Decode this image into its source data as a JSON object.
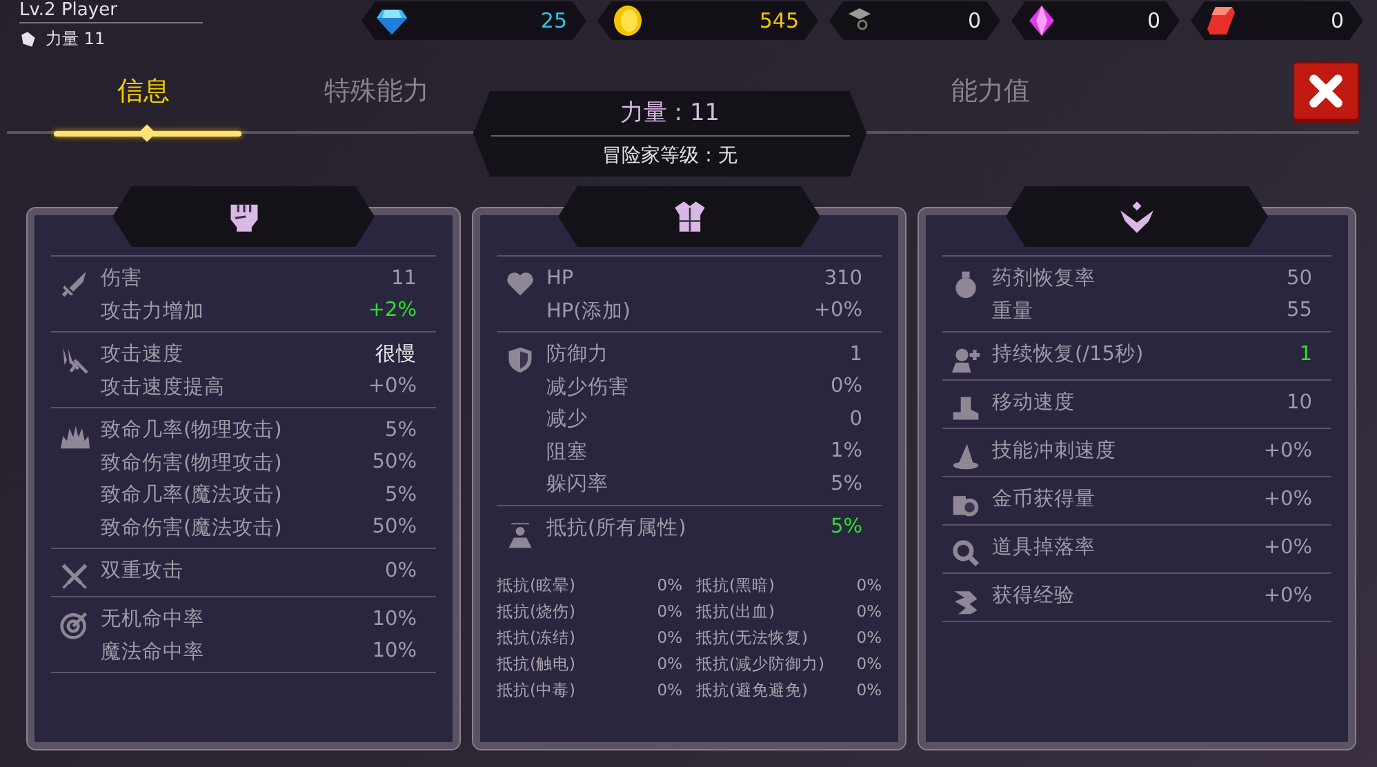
{
  "player": {
    "name": "Lv.2 Player",
    "stat": "力量 11"
  },
  "currencies": [
    {
      "kind": "diamond",
      "amount": "25"
    },
    {
      "kind": "gold",
      "amount": "545"
    },
    {
      "kind": "ore",
      "amount": "0"
    },
    {
      "kind": "crystal",
      "amount": "0"
    },
    {
      "kind": "ruby",
      "amount": "0"
    }
  ],
  "tabs": [
    {
      "label": "信息",
      "selected": true
    },
    {
      "label": "特殊能力",
      "selected": false
    },
    {
      "label": "能力值",
      "selected": false
    }
  ],
  "badge": {
    "title": "力量 : 11",
    "subtitle": "冒险家等级 : 无"
  },
  "panels": [
    {
      "groups": [
        {
          "rows": [
            {
              "label": "伤害",
              "value": "11",
              "kind": "normal"
            },
            {
              "label": "攻击力增加",
              "value": "+2%",
              "kind": "good"
            }
          ]
        },
        {
          "rows": [
            {
              "label": "攻击速度",
              "value": "很慢",
              "kind": "bright"
            },
            {
              "label": "攻击速度提高",
              "value": "+0%",
              "kind": "normal"
            }
          ]
        },
        {
          "rows": [
            {
              "label": "致命几率(物理攻击)",
              "value": "5%",
              "kind": "normal"
            },
            {
              "label": "致命伤害(物理攻击)",
              "value": "50%",
              "kind": "normal"
            },
            {
              "label": "致命几率(魔法攻击)",
              "value": "5%",
              "kind": "normal"
            },
            {
              "label": "致命伤害(魔法攻击)",
              "value": "50%",
              "kind": "normal"
            }
          ]
        },
        {
          "rows": [
            {
              "label": "双重攻击",
              "value": "0%",
              "kind": "normal"
            }
          ]
        },
        {
          "rows": [
            {
              "label": "无机命中率",
              "value": "10%",
              "kind": "normal"
            },
            {
              "label": "魔法命中率",
              "value": "10%",
              "kind": "normal"
            }
          ]
        }
      ]
    },
    {
      "groups": [
        {
          "rows": [
            {
              "label": "HP",
              "value": "310",
              "kind": "normal"
            },
            {
              "label": "HP(添加)",
              "value": "+0%",
              "kind": "normal"
            }
          ]
        },
        {
          "rows": [
            {
              "label": "防御力",
              "value": "1",
              "kind": "normal"
            },
            {
              "label": "减少伤害",
              "value": "0%",
              "kind": "normal"
            },
            {
              "label": "减少",
              "value": "0",
              "kind": "normal"
            },
            {
              "label": "阻塞",
              "value": "1%",
              "kind": "normal"
            },
            {
              "label": "躲闪率",
              "value": "5%",
              "kind": "normal"
            }
          ]
        },
        {
          "rows": [
            {
              "label": "抵抗(所有属性)",
              "value": "5%",
              "kind": "good"
            }
          ]
        }
      ],
      "resistances": [
        {
          "label": "抵抗(眩晕)",
          "value": "0%"
        },
        {
          "label": "抵抗(黑暗)",
          "value": "0%"
        },
        {
          "label": "抵抗(烧伤)",
          "value": "0%"
        },
        {
          "label": "抵抗(出血)",
          "value": "0%"
        },
        {
          "label": "抵抗(冻结)",
          "value": "0%"
        },
        {
          "label": "抵抗(无法恢复)",
          "value": "0%"
        },
        {
          "label": "抵抗(触电)",
          "value": "0%"
        },
        {
          "label": "抵抗(减少防御力)",
          "value": "0%"
        },
        {
          "label": "抵抗(中毒)",
          "value": "0%"
        },
        {
          "label": "抵抗(避免避免)",
          "value": "0%"
        }
      ]
    },
    {
      "groups": [
        {
          "rows": [
            {
              "label": "药剂恢复率",
              "value": "50",
              "kind": "normal"
            },
            {
              "label": "重量",
              "value": "55",
              "kind": "normal"
            }
          ]
        },
        {
          "rows": [
            {
              "label": "持续恢复(/15秒)",
              "value": "1",
              "kind": "good"
            }
          ]
        },
        {
          "rows": [
            {
              "label": "移动速度",
              "value": "10",
              "kind": "normal"
            }
          ]
        },
        {
          "rows": [
            {
              "label": "技能冲刺速度",
              "value": "+0%",
              "kind": "normal"
            }
          ]
        },
        {
          "rows": [
            {
              "label": "金币获得量",
              "value": "+0%",
              "kind": "normal"
            }
          ]
        },
        {
          "rows": [
            {
              "label": "道具掉落率",
              "value": "+0%",
              "kind": "normal"
            }
          ]
        },
        {
          "rows": [
            {
              "label": "获得经验",
              "value": "+0%",
              "kind": "normal"
            }
          ]
        }
      ]
    }
  ]
}
